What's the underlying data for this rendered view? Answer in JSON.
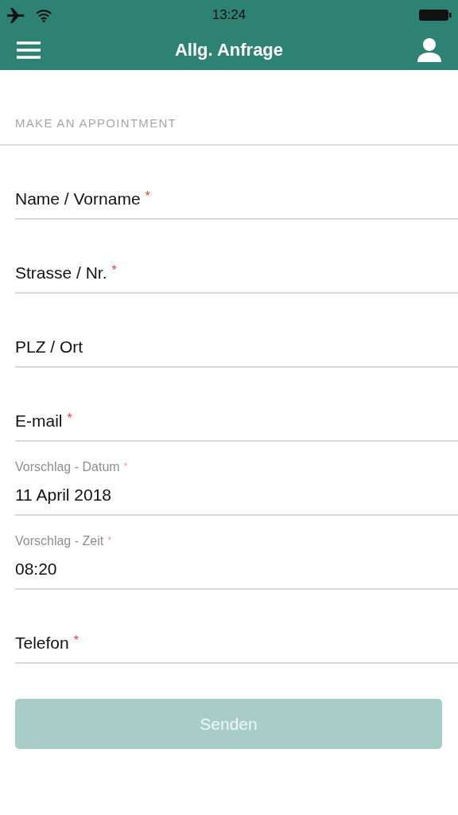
{
  "status_bar": {
    "time": "13:24"
  },
  "nav_bar": {
    "title": "Allg. Anfrage"
  },
  "section": {
    "title": "MAKE AN APPOINTMENT"
  },
  "fields": [
    {
      "placeholder": "Name / Vorname",
      "asterisk": "*"
    },
    {
      "placeholder": "Strasse / Nr.",
      "asterisk": "*"
    },
    {
      "placeholder": "PLZ / Ort"
    },
    {
      "placeholder": "E-mail",
      "asterisk": "*"
    },
    {
      "label": "Vorschlag - Datum",
      "asterisk": "*",
      "value": "11 April 2018"
    },
    {
      "label": "Vorschlag - Zeit",
      "asterisk": "*",
      "value": "08:20"
    },
    {
      "placeholder": "Telefon",
      "asterisk": "*"
    }
  ],
  "submit": {
    "label": "Senden",
    "disabled": true
  }
}
